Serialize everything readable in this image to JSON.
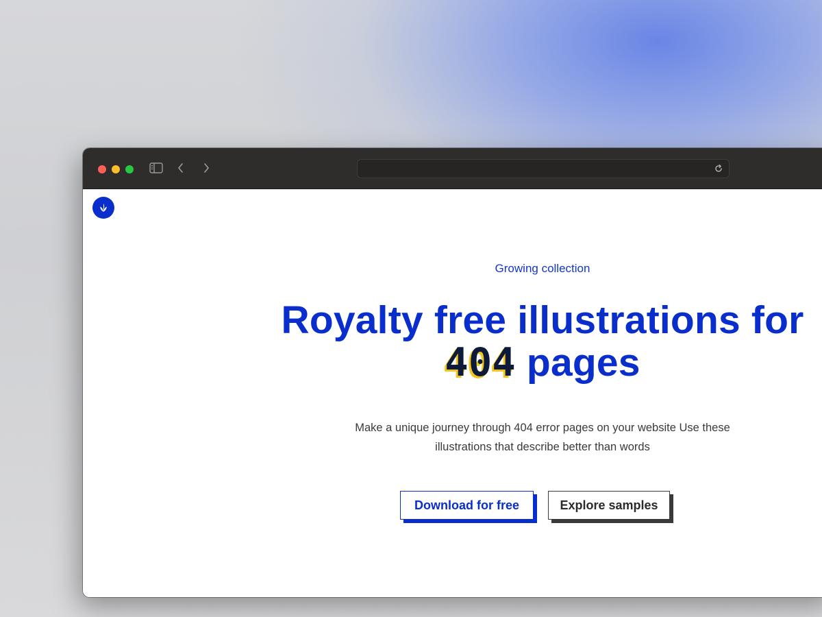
{
  "browser": {
    "icons": {
      "sidebar": "sidebar-toggle-icon",
      "back": "chevron-left-icon",
      "forward": "chevron-right-icon",
      "reload": "reload-icon"
    },
    "address_value": ""
  },
  "site": {
    "logo_icon": "leaf-icon",
    "eyebrow": "Growing collection",
    "headline_line1": "Royalty free illustrations for",
    "headline_number": "404",
    "headline_line2_rest": " pages",
    "subtitle_line1": "Make a unique journey through 404 error pages on your website Use these",
    "subtitle_line2": "illustrations that describe better than words",
    "primary_button": "Download for free",
    "secondary_button": "Explore samples"
  },
  "colors": {
    "brand_blue": "#0a2ecc",
    "accent_yellow": "#f2c61f",
    "titlebar": "#2e2d2b"
  }
}
